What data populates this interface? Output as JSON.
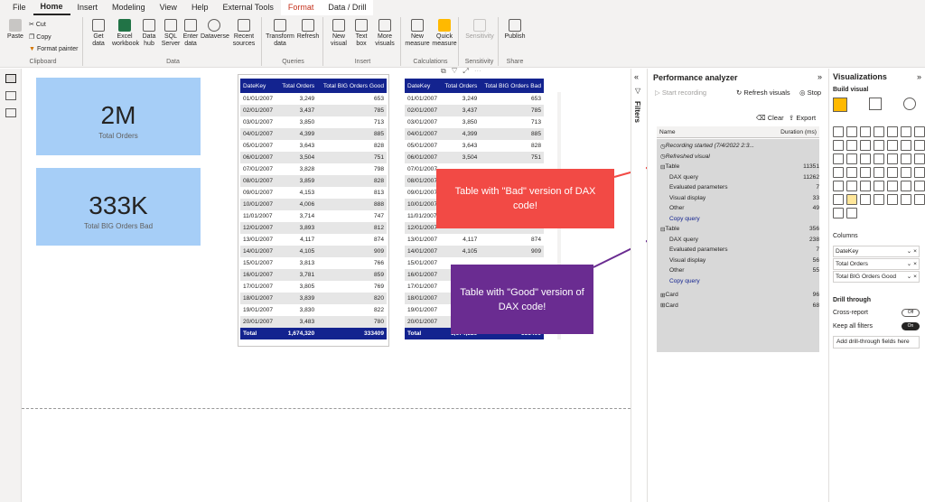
{
  "tabs": [
    "File",
    "Home",
    "Insert",
    "Modeling",
    "View",
    "Help",
    "External Tools",
    "Format",
    "Data / Drill"
  ],
  "ribbon": {
    "clipboard": {
      "paste": "Paste",
      "cut": "Cut",
      "copy": "Copy",
      "format_painter": "Format painter",
      "label": "Clipboard"
    },
    "data": {
      "get_data": "Get data",
      "excel": "Excel workbook",
      "data_hub": "Data hub",
      "sql": "SQL Server",
      "enter": "Enter data",
      "dataverse": "Dataverse",
      "recent": "Recent sources",
      "label": "Data"
    },
    "queries": {
      "transform": "Transform data",
      "refresh": "Refresh",
      "label": "Queries"
    },
    "insert": {
      "new_visual": "New visual",
      "text_box": "Text box",
      "more_visuals": "More visuals",
      "label": "Insert"
    },
    "calculations": {
      "new_measure": "New measure",
      "quick_measure": "Quick measure",
      "label": "Calculations"
    },
    "sensitivity": {
      "sensitivity": "Sensitivity",
      "label": "Sensitivity"
    },
    "share": {
      "publish": "Publish",
      "label": "Share"
    }
  },
  "cards": [
    {
      "value": "2M",
      "label": "Total Orders"
    },
    {
      "value": "333K",
      "label": "Total BIG Orders Bad"
    }
  ],
  "table_bad": {
    "headers": [
      "DateKey",
      "Total Orders",
      "Total BIG Orders Good"
    ],
    "rows": [
      [
        "01/01/2007",
        "3,249",
        "653"
      ],
      [
        "02/01/2007",
        "3,437",
        "785"
      ],
      [
        "03/01/2007",
        "3,850",
        "713"
      ],
      [
        "04/01/2007",
        "4,399",
        "885"
      ],
      [
        "05/01/2007",
        "3,643",
        "828"
      ],
      [
        "06/01/2007",
        "3,504",
        "751"
      ],
      [
        "07/01/2007",
        "3,828",
        "798"
      ],
      [
        "08/01/2007",
        "3,859",
        "828"
      ],
      [
        "09/01/2007",
        "4,153",
        "813"
      ],
      [
        "10/01/2007",
        "4,006",
        "888"
      ],
      [
        "11/01/2007",
        "3,714",
        "747"
      ],
      [
        "12/01/2007",
        "3,893",
        "812"
      ],
      [
        "13/01/2007",
        "4,117",
        "874"
      ],
      [
        "14/01/2007",
        "4,105",
        "909"
      ],
      [
        "15/01/2007",
        "3,813",
        "766"
      ],
      [
        "16/01/2007",
        "3,781",
        "859"
      ],
      [
        "17/01/2007",
        "3,805",
        "769"
      ],
      [
        "18/01/2007",
        "3,839",
        "820"
      ],
      [
        "19/01/2007",
        "3,830",
        "822"
      ],
      [
        "20/01/2007",
        "3,483",
        "780"
      ]
    ],
    "total": [
      "Total",
      "1,674,320",
      "333409"
    ]
  },
  "table_good": {
    "headers": [
      "DateKey",
      "Total Orders",
      "Total BIG Orders Bad"
    ],
    "rows": [
      [
        "01/01/2007",
        "3,249",
        "653"
      ],
      [
        "02/01/2007",
        "3,437",
        "785"
      ],
      [
        "03/01/2007",
        "3,850",
        "713"
      ],
      [
        "04/01/2007",
        "4,399",
        "885"
      ],
      [
        "05/01/2007",
        "3,643",
        "828"
      ],
      [
        "06/01/2007",
        "3,504",
        "751"
      ],
      [
        "07/01/2007",
        "",
        ""
      ],
      [
        "08/01/2007",
        "",
        ""
      ],
      [
        "09/01/2007",
        "",
        ""
      ],
      [
        "10/01/2007",
        "",
        ""
      ],
      [
        "11/01/2007",
        "",
        ""
      ],
      [
        "12/01/2007",
        "",
        ""
      ],
      [
        "13/01/2007",
        "4,117",
        "874"
      ],
      [
        "14/01/2007",
        "4,105",
        "909"
      ],
      [
        "15/01/2007",
        "",
        ""
      ],
      [
        "16/01/2007",
        "",
        ""
      ],
      [
        "17/01/2007",
        "",
        ""
      ],
      [
        "18/01/2007",
        "",
        ""
      ],
      [
        "19/01/2007",
        "",
        ""
      ],
      [
        "20/01/2007",
        "",
        ""
      ]
    ],
    "total": [
      "Total",
      "1,674,320",
      "333409"
    ]
  },
  "callouts": {
    "bad": "Table with \"Bad\" version of DAX code!",
    "good": "Table with \"Good\" version of DAX code!"
  },
  "filters_label": "Filters",
  "perf": {
    "title": "Performance analyzer",
    "start": "Start recording",
    "refresh": "Refresh visuals",
    "stop": "Stop",
    "clear": "Clear",
    "export": "Export",
    "col_name": "Name",
    "col_dur": "Duration (ms)",
    "recording": "Recording started (7/4/2022 2:3...",
    "refreshed": "Refreshed visual",
    "groups": [
      {
        "name": "Table",
        "total": "11351",
        "items": [
          [
            "DAX query",
            "11262"
          ],
          [
            "Evaluated parameters",
            "7"
          ],
          [
            "Visual display",
            "33"
          ],
          [
            "Other",
            "49"
          ]
        ],
        "copy": "Copy query"
      },
      {
        "name": "Table",
        "total": "356",
        "items": [
          [
            "DAX query",
            "238"
          ],
          [
            "Evaluated parameters",
            "7"
          ],
          [
            "Visual display",
            "56"
          ],
          [
            "Other",
            "55"
          ]
        ],
        "copy": "Copy query"
      }
    ],
    "cards": [
      [
        "Card",
        "96"
      ],
      [
        "Card",
        "68"
      ]
    ]
  },
  "viz": {
    "title": "Visualizations",
    "build": "Build visual",
    "columns_label": "Columns",
    "columns": [
      "DateKey",
      "Total Orders",
      "Total BIG Orders Good"
    ],
    "drill": "Drill through",
    "cross": "Cross-report",
    "keep": "Keep all filters",
    "add": "Add drill-through fields here",
    "off": "Off",
    "on": "On"
  },
  "colors": {
    "accent": "#13238f",
    "card": "#a6cef7",
    "red": "#f24a45",
    "purple": "#6a2c91"
  }
}
